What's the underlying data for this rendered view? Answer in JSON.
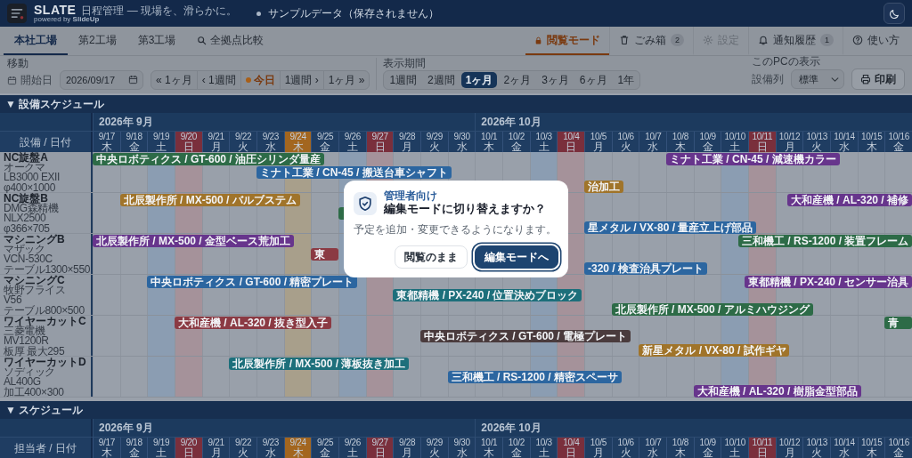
{
  "header": {
    "app_name": "SLATE",
    "tagline": "日程管理 — 現場を、滑らかに。",
    "powered_by": "powered by **SlideUp**",
    "status": "サンプルデータ（保存されません）"
  },
  "site_tabs": [
    {
      "kind": "site",
      "label": "本社工場",
      "selected": true
    },
    {
      "kind": "site",
      "label": "第2工場",
      "selected": false
    },
    {
      "kind": "site",
      "label": "第3工場",
      "selected": false
    },
    {
      "kind": "compare",
      "label": "全拠点比較",
      "selected": false
    }
  ],
  "menu_tabs": [
    {
      "kind": "mode",
      "label": "閲覧モード",
      "selected": true,
      "disabled": false
    },
    {
      "kind": "trash",
      "label": "ごみ箱",
      "count": "2",
      "selected": false,
      "disabled": false
    },
    {
      "kind": "settings",
      "label": "設定",
      "selected": false,
      "disabled": true
    },
    {
      "kind": "notifications",
      "label": "通知履歴",
      "count": "1",
      "selected": false,
      "disabled": false
    },
    {
      "kind": "help",
      "label": "使い方",
      "selected": false,
      "disabled": false
    }
  ],
  "toolbar": {
    "move": {
      "label": "移動",
      "date_label": "開始日",
      "date_value": "2026/09/17",
      "buttons": [
        {
          "kind": "step",
          "label": "« 1ヶ月"
        },
        {
          "kind": "step",
          "label": "‹ 1週間"
        },
        {
          "kind": "today",
          "label": "今日"
        },
        {
          "kind": "step",
          "label": "1週間 ›"
        },
        {
          "kind": "step",
          "label": "1ヶ月 »"
        }
      ]
    },
    "range": {
      "label": "表示期間",
      "options": [
        {
          "label": "1週間",
          "selected": false
        },
        {
          "label": "2週間",
          "selected": false
        },
        {
          "label": "1ヶ月",
          "selected": true
        },
        {
          "label": "2ヶ月",
          "selected": false
        },
        {
          "label": "3ヶ月",
          "selected": false
        },
        {
          "label": "6ヶ月",
          "selected": false
        },
        {
          "label": "1年",
          "selected": false
        }
      ]
    },
    "display": {
      "label": "このPCの表示",
      "column_label": "設備列",
      "column_value": "標準",
      "print_label": "印刷"
    }
  },
  "sections": [
    {
      "title": "▼ 設備スケジュール",
      "corner": "設備 / 日付",
      "days": [
        {
          "date": "9/17",
          "weekday": "木",
          "kind": "weekday",
          "month": "2026年 9月"
        },
        {
          "date": "9/18",
          "weekday": "金",
          "kind": "weekday"
        },
        {
          "date": "9/19",
          "weekday": "土",
          "kind": "saturday"
        },
        {
          "date": "9/20",
          "weekday": "日",
          "kind": "sunday"
        },
        {
          "date": "9/21",
          "weekday": "月",
          "kind": "weekday"
        },
        {
          "date": "9/22",
          "weekday": "火",
          "kind": "weekday"
        },
        {
          "date": "9/23",
          "weekday": "水",
          "kind": "weekday"
        },
        {
          "date": "9/24",
          "weekday": "木",
          "kind": "today"
        },
        {
          "date": "9/25",
          "weekday": "金",
          "kind": "weekday"
        },
        {
          "date": "9/26",
          "weekday": "土",
          "kind": "saturday"
        },
        {
          "date": "9/27",
          "weekday": "日",
          "kind": "sunday"
        },
        {
          "date": "9/28",
          "weekday": "月",
          "kind": "weekday"
        },
        {
          "date": "9/29",
          "weekday": "火",
          "kind": "weekday"
        },
        {
          "date": "9/30",
          "weekday": "水",
          "kind": "weekday"
        },
        {
          "date": "10/1",
          "weekday": "木",
          "kind": "weekday",
          "month": "2026年 10月"
        },
        {
          "date": "10/2",
          "weekday": "金",
          "kind": "weekday"
        },
        {
          "date": "10/3",
          "weekday": "土",
          "kind": "saturday"
        },
        {
          "date": "10/4",
          "weekday": "日",
          "kind": "sunday"
        },
        {
          "date": "10/5",
          "weekday": "月",
          "kind": "weekday"
        },
        {
          "date": "10/6",
          "weekday": "火",
          "kind": "weekday"
        },
        {
          "date": "10/7",
          "weekday": "水",
          "kind": "weekday"
        },
        {
          "date": "10/8",
          "weekday": "木",
          "kind": "weekday"
        },
        {
          "date": "10/9",
          "weekday": "金",
          "kind": "weekday"
        },
        {
          "date": "10/10",
          "weekday": "土",
          "kind": "saturday"
        },
        {
          "date": "10/11",
          "weekday": "日",
          "kind": "sunday"
        },
        {
          "date": "10/12",
          "weekday": "月",
          "kind": "weekday"
        },
        {
          "date": "10/13",
          "weekday": "火",
          "kind": "weekday"
        },
        {
          "date": "10/14",
          "weekday": "水",
          "kind": "weekday"
        },
        {
          "date": "10/15",
          "weekday": "木",
          "kind": "weekday"
        },
        {
          "date": "10/16",
          "weekday": "金",
          "kind": "weekday"
        }
      ],
      "rows": [
        {
          "name": "NC旋盤A",
          "details": [
            "オークマ",
            "LB3000 EXII",
            "φ400×1000"
          ],
          "lanes": [
            [
              {
                "label": "中央ロボティクス / GT-600 / 油圧シリンダ量産",
                "color": "#2d6b47"
              },
              {
                "label": "ミナト工業 / CN-45 / 減速機カラー",
                "color": "#67358c"
              }
            ],
            [
              {
                "label": "ミナト工業 / CN-45 / 搬送台車シャフト",
                "color": "#2c66a0"
              }
            ],
            [
              {
                "label": "治加工",
                "color": "#a0742a"
              }
            ]
          ]
        },
        {
          "name": "NC旋盤B",
          "details": [
            "DMG森精機",
            "NLX2500",
            "φ366×705"
          ],
          "lanes": [
            [
              {
                "label": "北辰製作所 / MX-500 / バルブステム",
                "color": "#a0742a"
              },
              {
                "label": "大和産機 / AL-320 / 補修",
                "color": "#67358c"
              }
            ],
            [
              {
                "color": "#2d6b47"
              }
            ],
            [
              {
                "label": "星メタル / VX-80 / 量産立上げ部品",
                "color": "#2c66a0"
              }
            ]
          ]
        },
        {
          "name": "マシニングB",
          "details": [
            "マザック",
            "VCN-530C",
            "テーブル1300×550"
          ],
          "lanes": [
            [
              {
                "label": "北辰製作所 / MX-500 / 金型ベース荒加工",
                "color": "#67358c"
              },
              {
                "label": "三和機工 / RS-1200 / 装置フレーム",
                "color": "#2d6b47"
              }
            ],
            [
              {
                "label": "東",
                "color": "#8b3a43"
              }
            ],
            [
              {
                "label": "-320 / 検査治具プレート",
                "color": "#2c66a0"
              }
            ]
          ]
        },
        {
          "name": "マシニングC",
          "details": [
            "牧野フライス",
            "V56",
            "テーブル800×500"
          ],
          "lanes": [
            [
              {
                "label": "中央ロボティクス / GT-600 / 精密プレート",
                "color": "#2c66a0"
              },
              {
                "label": "東都精機 / PX-240 / センサー治具",
                "color": "#67358c"
              }
            ],
            [
              {
                "label": "東都精機 / PX-240 / 位置決めブロック",
                "color": "#1d6f7b"
              }
            ],
            [
              {
                "label": "北辰製作所 / MX-500 / アルミハウジング",
                "color": "#2d6b47"
              }
            ]
          ]
        },
        {
          "name": "ワイヤーカットC",
          "details": [
            "三菱電機",
            "MV1200R",
            "板厚 最大295"
          ],
          "lanes": [
            [
              {
                "label": "大和産機 / AL-320 / 抜き型入子",
                "color": "#8b3a43"
              },
              {
                "label": "青",
                "color": "#2d6b47"
              }
            ],
            [
              {
                "label": "中央ロボティクス / GT-600 / 電極プレート",
                "color": "#4a3b3d"
              }
            ],
            [
              {
                "label": "新星メタル / VX-80 / 試作ギヤ",
                "color": "#a0742a"
              }
            ]
          ]
        },
        {
          "name": "ワイヤーカットD",
          "details": [
            "ソディック",
            "AL400G",
            "加工400×300"
          ],
          "lanes": [
            [
              {
                "label": "北辰製作所 / MX-500 / 薄板抜き加工",
                "color": "#1d6f7b"
              }
            ],
            [
              {
                "label": "三和機工 / RS-1200 / 精密スペーサ",
                "color": "#2c66a0"
              }
            ],
            [
              {
                "label": "大和産機 / AL-320 / 樹脂金型部品",
                "color": "#67358c"
              }
            ]
          ]
        }
      ]
    },
    {
      "title": "▼ スケジュール",
      "corner": "担当者 / 日付",
      "days": [
        {
          "date": "9/17",
          "weekday": "木",
          "kind": "weekday",
          "month": "2026年 9月"
        },
        {
          "date": "9/18",
          "weekday": "金",
          "kind": "weekday"
        },
        {
          "date": "9/19",
          "weekday": "土",
          "kind": "saturday"
        },
        {
          "date": "9/20",
          "weekday": "日",
          "kind": "sunday"
        },
        {
          "date": "9/21",
          "weekday": "月",
          "kind": "weekday"
        },
        {
          "date": "9/22",
          "weekday": "火",
          "kind": "weekday"
        },
        {
          "date": "9/23",
          "weekday": "水",
          "kind": "weekday"
        },
        {
          "date": "9/24",
          "weekday": "木",
          "kind": "today"
        },
        {
          "date": "9/25",
          "weekday": "金",
          "kind": "weekday"
        },
        {
          "date": "9/26",
          "weekday": "土",
          "kind": "saturday"
        },
        {
          "date": "9/27",
          "weekday": "日",
          "kind": "sunday"
        },
        {
          "date": "9/28",
          "weekday": "月",
          "kind": "weekday"
        },
        {
          "date": "9/29",
          "weekday": "火",
          "kind": "weekday"
        },
        {
          "date": "9/30",
          "weekday": "水",
          "kind": "weekday"
        },
        {
          "date": "10/1",
          "weekday": "木",
          "kind": "weekday",
          "month": "2026年 10月"
        },
        {
          "date": "10/2",
          "weekday": "金",
          "kind": "weekday"
        },
        {
          "date": "10/3",
          "weekday": "土",
          "kind": "saturday"
        },
        {
          "date": "10/4",
          "weekday": "日",
          "kind": "sunday"
        },
        {
          "date": "10/5",
          "weekday": "月",
          "kind": "weekday"
        },
        {
          "date": "10/6",
          "weekday": "火",
          "kind": "weekday"
        },
        {
          "date": "10/7",
          "weekday": "水",
          "kind": "weekday"
        },
        {
          "date": "10/8",
          "weekday": "木",
          "kind": "weekday"
        },
        {
          "date": "10/9",
          "weekday": "金",
          "kind": "weekday"
        },
        {
          "date": "10/10",
          "weekday": "土",
          "kind": "saturday"
        },
        {
          "date": "10/11",
          "weekday": "日",
          "kind": "sunday"
        },
        {
          "date": "10/12",
          "weekday": "月",
          "kind": "weekday"
        },
        {
          "date": "10/13",
          "weekday": "火",
          "kind": "weekday"
        },
        {
          "date": "10/14",
          "weekday": "水",
          "kind": "weekday"
        },
        {
          "date": "10/15",
          "weekday": "木",
          "kind": "weekday"
        },
        {
          "date": "10/16",
          "weekday": "金",
          "kind": "weekday"
        }
      ]
    }
  ],
  "modal": {
    "eyebrow": "管理者向け",
    "title": "編集モードに切り替えますか？",
    "message": "予定を追加・変更できるようになります。",
    "buttons": [
      {
        "kind": "secondary",
        "label": "閲覧のまま"
      },
      {
        "kind": "primary",
        "label": "編集モードへ"
      }
    ]
  }
}
